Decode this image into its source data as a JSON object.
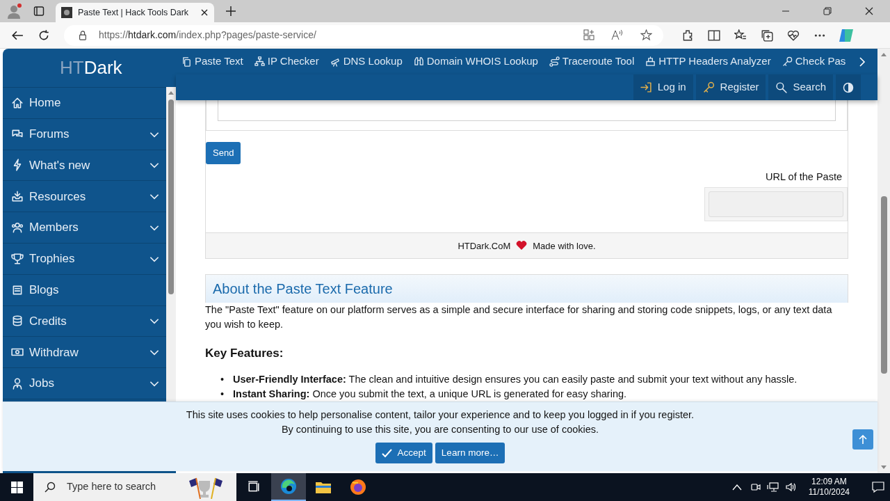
{
  "browser": {
    "tab": {
      "title": "Paste Text | Hack Tools Dark"
    },
    "url": {
      "scheme": "https://",
      "host": "htdark.com",
      "path": "/index.php?pages/paste-service/"
    }
  },
  "sidebar": {
    "logo": {
      "prefix": "HT",
      "name": "Dark"
    },
    "items": [
      {
        "label": "Home",
        "has_submenu": false
      },
      {
        "label": "Forums",
        "has_submenu": true
      },
      {
        "label": "What's new",
        "has_submenu": true
      },
      {
        "label": "Resources",
        "has_submenu": true
      },
      {
        "label": "Members",
        "has_submenu": true
      },
      {
        "label": "Trophies",
        "has_submenu": true
      },
      {
        "label": "Blogs",
        "has_submenu": false
      },
      {
        "label": "Credits",
        "has_submenu": true
      },
      {
        "label": "Withdraw",
        "has_submenu": true
      },
      {
        "label": "Jobs",
        "has_submenu": true
      }
    ]
  },
  "top_nav": {
    "links": [
      "Paste Text",
      "IP Checker",
      "DNS Lookup",
      "Domain WHOIS Lookup",
      "Traceroute Tool",
      "HTTP Headers Analyzer",
      "Check Pas"
    ],
    "account": [
      "Log in",
      "Register",
      "Search"
    ]
  },
  "paste_form": {
    "send_button": "Send",
    "url_label": "URL of the Paste",
    "footer": {
      "site": "HTDark.CoM",
      "text": "Made with love."
    }
  },
  "about": {
    "title": "About the Paste Text Feature",
    "intro": "The \"Paste Text\" feature on our platform serves as a simple and secure interface for sharing and storing code snippets, logs, or any text data you wish to keep.",
    "features_title": "Key Features:",
    "features": [
      {
        "marker": "•",
        "text": "**User-Friendly Interface:** The clean and intuitive design ensures you can easily paste and submit your text without any hassle."
      },
      {
        "marker": "•",
        "text": "**Instant Sharing:** Once you submit the text, a unique URL is generated for easy sharing."
      }
    ]
  },
  "cookie_notice": {
    "lines": [
      "This site uses cookies to help personalise content, tailor your experience and to keep you logged in if you register.",
      "By continuing to use this site, you are consenting to our use of cookies."
    ],
    "buttons": [
      {
        "label": "Accept",
        "kind": "accept"
      },
      {
        "label": "Learn more…",
        "kind": "more"
      }
    ]
  },
  "taskbar": {
    "search_placeholder": "Type here to search",
    "apps": [
      {
        "selected": false
      },
      {
        "selected": true
      },
      {
        "selected": false
      },
      {
        "selected": false
      }
    ],
    "clock": {
      "time": "12:09 AM",
      "date": "11/10/2024"
    }
  }
}
